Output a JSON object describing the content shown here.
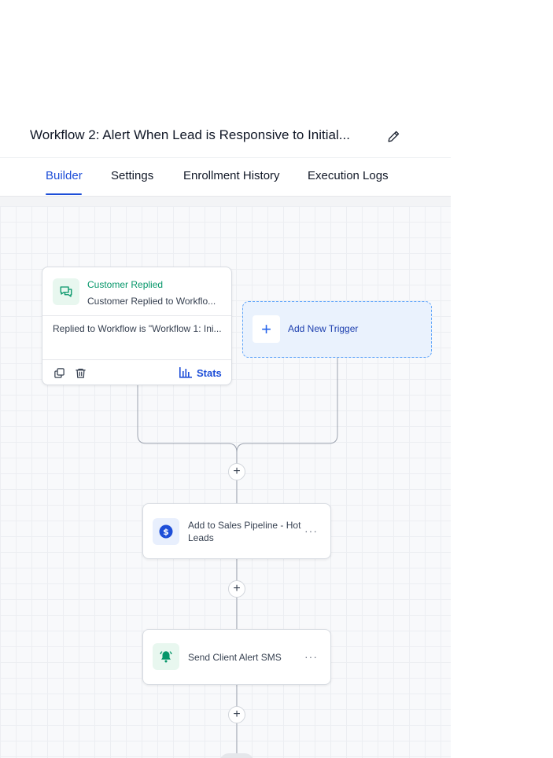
{
  "workflow": {
    "title": "Workflow 2: Alert When Lead is Responsive to Initial..."
  },
  "tabs": [
    {
      "label": "Builder",
      "active": true
    },
    {
      "label": "Settings",
      "active": false
    },
    {
      "label": "Enrollment History",
      "active": false
    },
    {
      "label": "Execution Logs",
      "active": false
    }
  ],
  "trigger": {
    "title": "Customer Replied",
    "subtitle": "Customer Replied to Workflo...",
    "condition": "Replied to Workflow is \"Workflow 1: Ini...",
    "stats_label": "Stats",
    "icon": "chat-bubbles-icon"
  },
  "add_trigger": {
    "label": "Add New Trigger"
  },
  "actions": [
    {
      "label": "Add to Sales Pipeline - Hot Leads",
      "icon": "dollar-icon",
      "color": "#2563eb"
    },
    {
      "label": "Send Client Alert SMS",
      "icon": "bell-alert-icon",
      "color": "#059669"
    }
  ],
  "colors": {
    "accent": "#1d4ed8",
    "trigger_green": "#059669",
    "dashed_border": "#60a5fa"
  }
}
